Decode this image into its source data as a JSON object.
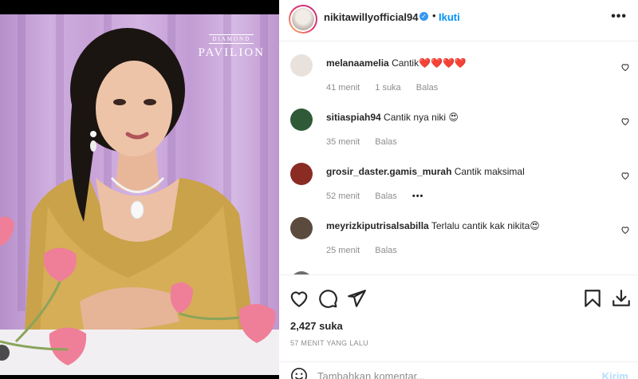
{
  "post": {
    "brand_top": "DIAMOND",
    "brand_name": "PAVILION"
  },
  "header": {
    "username": "nikitawillyofficial94",
    "verified_mark": "✓",
    "separator": "•",
    "follow_label": "Ikuti",
    "more_label": "•••"
  },
  "comments": [
    {
      "user": "melanaamelia",
      "text": "Cantik❤️❤️❤️❤️",
      "time": "41 menit",
      "likes": "1 suka",
      "reply": "Balas",
      "avatar_color": "#e9e2dc"
    },
    {
      "user": "sitiaspiah94",
      "text": "Cantik nya niki 😍",
      "time": "35 menit",
      "likes": "",
      "reply": "Balas",
      "avatar_color": "#2f5a37"
    },
    {
      "user": "grosir_daster.gamis_murah",
      "text": "Cantik maksimal",
      "time": "52 menit",
      "likes": "",
      "reply": "Balas",
      "avatar_color": "#8a2b24",
      "more": "•••"
    },
    {
      "user": "meyrizkiputrisalsabilla",
      "text": "Terlalu cantik kak nikita😍",
      "time": "25 menit",
      "likes": "",
      "reply": "Balas",
      "avatar_color": "#5b4a3e"
    }
  ],
  "actions": {
    "likes_count": "2,427 suka",
    "timestamp": "57 MENIT YANG LALU"
  },
  "add_comment": {
    "placeholder": "Tambahkan komentar...",
    "post_label": "Kirim"
  },
  "icons": [
    "heart-icon",
    "comment-icon",
    "share-icon",
    "bookmark-icon",
    "download-icon",
    "emoji-icon",
    "verified-icon",
    "more-icon"
  ],
  "colors": {
    "accent": "#0095f6",
    "verified": "#3897f0",
    "muted": "#8e8e8e",
    "disabled_post": "#b2dffc"
  }
}
